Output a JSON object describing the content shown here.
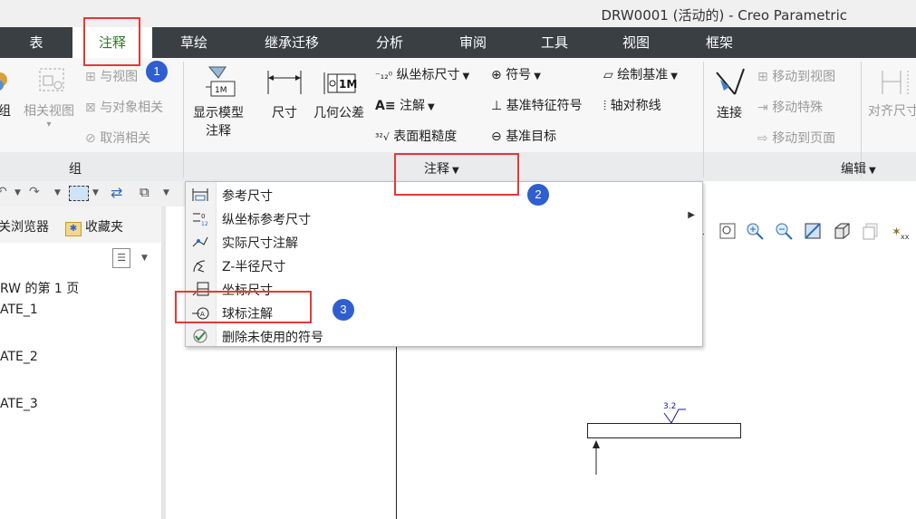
{
  "window": {
    "title": "DRW0001 (活动的) - Creo Parametric"
  },
  "menu": {
    "tabs": [
      {
        "label": "表"
      },
      {
        "label": "注释"
      },
      {
        "label": "草绘"
      },
      {
        "label": "继承迁移"
      },
      {
        "label": "分析"
      },
      {
        "label": "审阅"
      },
      {
        "label": "工具"
      },
      {
        "label": "视图"
      },
      {
        "label": "框架"
      }
    ]
  },
  "ribbon": {
    "group_partial": {
      "label": "组",
      "related_view": "相关视图",
      "with_view": "与视图",
      "with_object": "与对象相关",
      "cancel_related": "取消相关"
    },
    "annotate_group": {
      "show_model_annotation": "显示模型\n注释",
      "show_model_annotation_l1": "显示模型",
      "show_model_annotation_l2": "注释",
      "dimension": "尺寸",
      "gtol": "几何公差",
      "ordinate_dim": "纵坐标尺寸",
      "note": "注解",
      "surface_finish": "表面粗糙度",
      "symbol": "符号",
      "datum_feature_symbol": "基准特征符号",
      "datum_target": "基准目标",
      "draw_datum": "绘制基准",
      "axis_symmetry": "轴对称线",
      "label": "注释"
    },
    "edit_group": {
      "connect": "连接",
      "move_to_view": "移动到视图",
      "move_special": "移动特殊",
      "move_to_page": "移动到页面",
      "align_dimension": "对齐尺寸",
      "label": "编辑"
    }
  },
  "panel": {
    "tabs": {
      "browser": "关浏览器",
      "favorites": "收藏夹"
    },
    "tree": [
      "RW 的第 1 页",
      "ATE_1",
      "ATE_2",
      "ATE_3"
    ]
  },
  "dropdown": {
    "items": [
      {
        "label": "参考尺寸"
      },
      {
        "label": "纵坐标参考尺寸"
      },
      {
        "label": "实际尺寸注解"
      },
      {
        "label": "Z-半径尺寸"
      },
      {
        "label": "坐标尺寸"
      },
      {
        "label": "球标注解"
      },
      {
        "label": "删除未使用的符号"
      }
    ]
  },
  "callouts": {
    "one": "1",
    "two": "2",
    "three": "3"
  },
  "drawing": {
    "finish_value": "3.2"
  },
  "colors": {
    "menubar": "#3a3f44",
    "active_tab_text": "#2b7a2b",
    "callout_box": "#e53935",
    "badge": "#2f5fcf"
  }
}
